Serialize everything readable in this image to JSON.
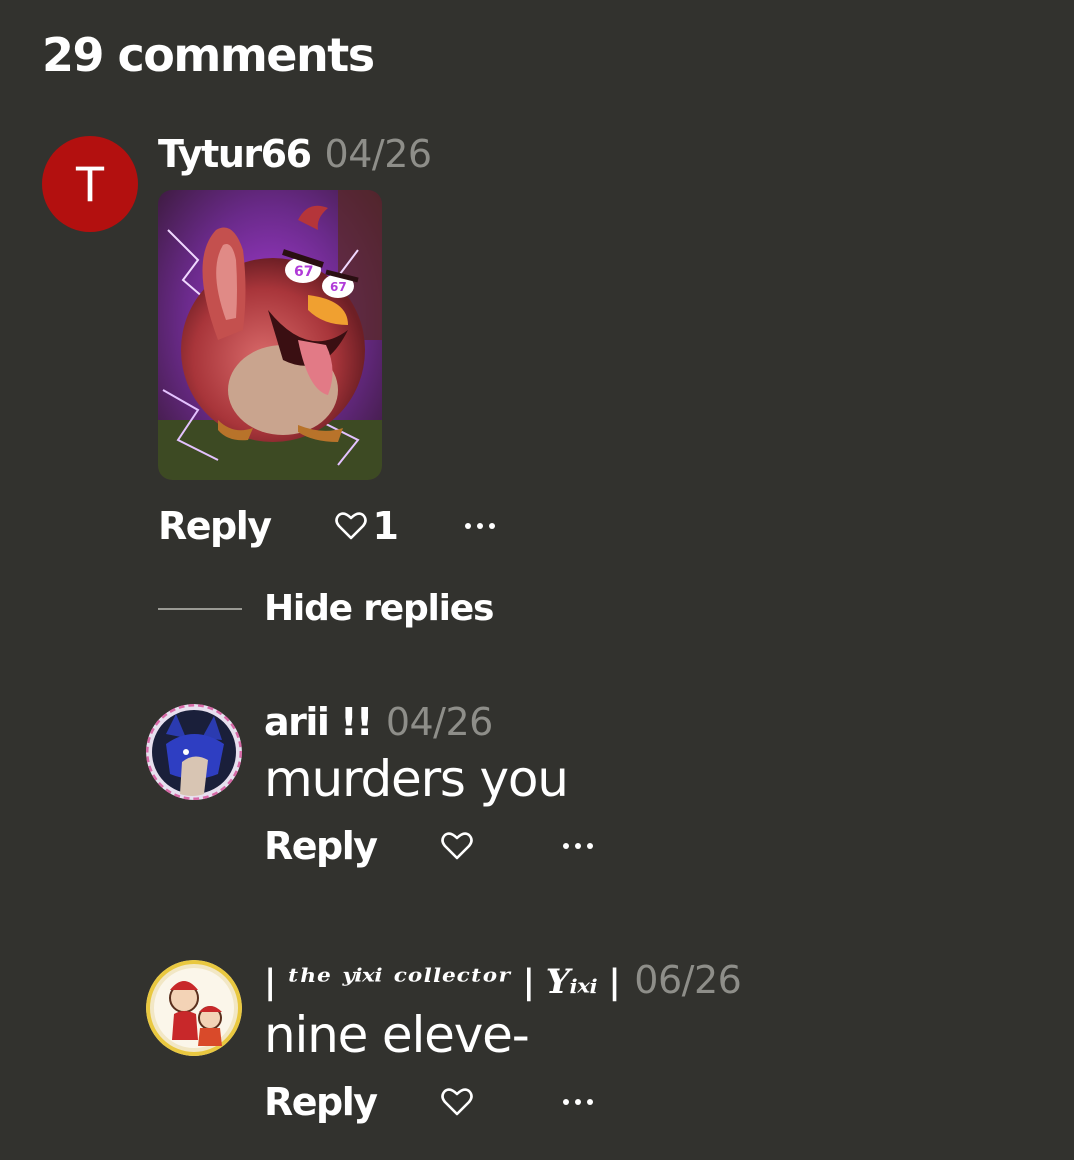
{
  "header": {
    "title": "29 comments"
  },
  "comments": [
    {
      "avatar_letter": "T",
      "username": "Tytur66",
      "date": "04/26",
      "reply_label": "Reply",
      "like_count": "1",
      "hide_replies_label": "Hide replies"
    }
  ],
  "replies": [
    {
      "username": "arii !!",
      "date": "04/26",
      "text": "murders you",
      "reply_label": "Reply"
    },
    {
      "username": "| ᵗʰᵉ ʸⁱˣⁱ ᶜᵒˡˡᵉᶜᵗᵒʳ | Yᵢₓᵢ |",
      "date": "06/26",
      "text": "nine eleve-",
      "reply_label": "Reply"
    }
  ],
  "colors": {
    "background": "#32322e",
    "avatar_red": "#b3100f",
    "date_gray": "#8e8e89"
  }
}
